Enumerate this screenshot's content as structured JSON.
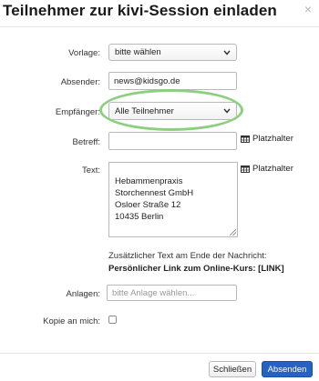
{
  "dialog": {
    "title": "Teilnehmer zur kivi-Session einladen",
    "close_glyph": "×"
  },
  "form": {
    "vorlage": {
      "label": "Vorlage:",
      "value": "bitte wählen"
    },
    "absender": {
      "label": "Absender:",
      "value": "news@kidsgo.de"
    },
    "empfaenger": {
      "label": "Empfänger:",
      "value": "Alle Teilnehmer"
    },
    "betreff": {
      "label": "Betreff:",
      "value": "",
      "placeholder_button": "Platzhalter"
    },
    "text": {
      "label": "Text:",
      "placeholder_button": "Platzhalter",
      "lines": [
        "Hebammenpraxis",
        "Storchennest GmbH",
        "Osloer Straße 12",
        "10435 Berlin"
      ]
    },
    "extra_text": {
      "heading": "Zusätzlicher Text am Ende der Nachricht:",
      "link_line": "Persönlicher Link zum Online-Kurs: [LINK]"
    },
    "anlagen": {
      "label": "Anlagen:",
      "placeholder": "bitte Anlage wählen..."
    },
    "kopie": {
      "label": "Kopie an mich:",
      "checked": false
    }
  },
  "footer": {
    "close_label": "Schließen",
    "send_label": "Absenden"
  },
  "colors": {
    "primary": "#2463c5",
    "highlight": "#8ccf7e"
  }
}
